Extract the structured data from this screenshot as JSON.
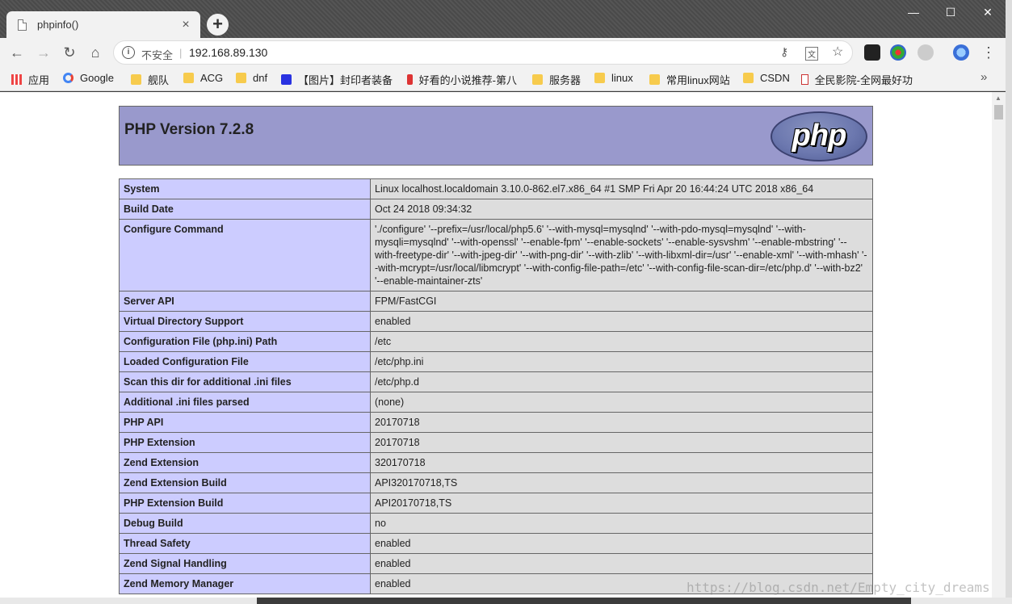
{
  "window": {
    "tab_title": "phpinfo()",
    "tab_close": "×",
    "new_tab": "+",
    "minimize": "—",
    "maximize": "☐",
    "close": "✕"
  },
  "toolbar": {
    "back": "←",
    "forward": "→",
    "reload": "↻",
    "home": "⌂",
    "security_label": "不安全",
    "separator": "|",
    "url": "192.168.89.130",
    "menu": "⋮"
  },
  "bookmarks": {
    "apps": "应用",
    "items": [
      "Google",
      "舰队",
      "ACG",
      "dnf",
      "【图片】封印者装备",
      "好看的小说推荐-第八",
      "服务器",
      "linux",
      "常用linux网站",
      "CSDN",
      "全民影院-全网最好功"
    ],
    "overflow": "»"
  },
  "page": {
    "title": "PHP Version 7.2.8",
    "logo_text": "php",
    "rows": [
      {
        "key": "System",
        "value": "Linux localhost.localdomain 3.10.0-862.el7.x86_64 #1 SMP Fri Apr 20 16:44:24 UTC 2018 x86_64"
      },
      {
        "key": "Build Date",
        "value": "Oct 24 2018 09:34:32"
      },
      {
        "key": "Configure Command",
        "value": "'./configure' '--prefix=/usr/local/php5.6' '--with-mysql=mysqlnd' '--with-pdo-mysql=mysqlnd' '--with-mysqli=mysqlnd' '--with-openssl' '--enable-fpm' '--enable-sockets' '--enable-sysvshm' '--enable-mbstring' '--with-freetype-dir' '--with-jpeg-dir' '--with-png-dir' '--with-zlib' '--with-libxml-dir=/usr' '--enable-xml' '--with-mhash' '--with-mcrypt=/usr/local/libmcrypt' '--with-config-file-path=/etc' '--with-config-file-scan-dir=/etc/php.d' '--with-bz2' '--enable-maintainer-zts'"
      },
      {
        "key": "Server API",
        "value": "FPM/FastCGI"
      },
      {
        "key": "Virtual Directory Support",
        "value": "enabled"
      },
      {
        "key": "Configuration File (php.ini) Path",
        "value": "/etc"
      },
      {
        "key": "Loaded Configuration File",
        "value": "/etc/php.ini"
      },
      {
        "key": "Scan this dir for additional .ini files",
        "value": "/etc/php.d"
      },
      {
        "key": "Additional .ini files parsed",
        "value": "(none)"
      },
      {
        "key": "PHP API",
        "value": "20170718"
      },
      {
        "key": "PHP Extension",
        "value": "20170718"
      },
      {
        "key": "Zend Extension",
        "value": "320170718"
      },
      {
        "key": "Zend Extension Build",
        "value": "API320170718,TS"
      },
      {
        "key": "PHP Extension Build",
        "value": "API20170718,TS"
      },
      {
        "key": "Debug Build",
        "value": "no"
      },
      {
        "key": "Thread Safety",
        "value": "enabled"
      },
      {
        "key": "Zend Signal Handling",
        "value": "enabled"
      },
      {
        "key": "Zend Memory Manager",
        "value": "enabled"
      }
    ]
  },
  "watermark": "https://blog.csdn.net/Empty_city_dreams"
}
